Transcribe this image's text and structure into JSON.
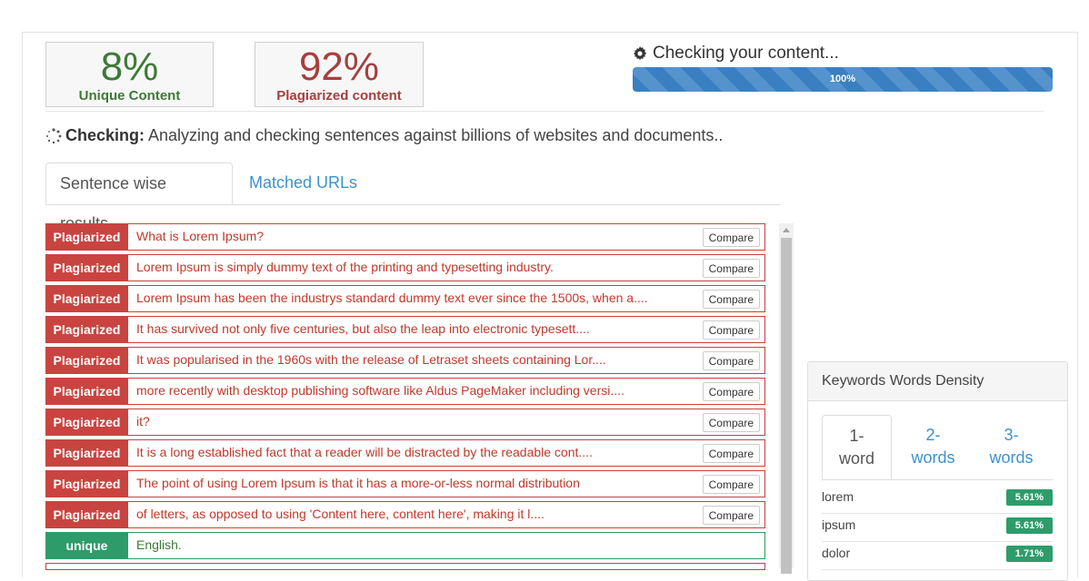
{
  "scores": {
    "unique": {
      "percent": "8%",
      "label": "Unique Content",
      "color": "#3d7a36"
    },
    "plagiarized": {
      "percent": "92%",
      "label": "Plagiarized content",
      "color": "#a5403d"
    }
  },
  "progress": {
    "title": "Checking your content...",
    "icon": "gear-icon",
    "value": 1.0,
    "label": "100%",
    "color": "#3a7fbf"
  },
  "status": {
    "icon": "spinner-icon",
    "label": "Checking:",
    "text": "Analyzing and checking sentences against billions of websites and documents.."
  },
  "tabs": [
    {
      "label": "Sentence wise results",
      "active": true
    },
    {
      "label": "Matched URLs",
      "active": false
    }
  ],
  "results": [
    {
      "status": "Plagiarized",
      "text": "What is Lorem Ipsum?",
      "button": "Compare"
    },
    {
      "status": "Plagiarized",
      "text": "Lorem Ipsum is simply dummy text of the printing and typesetting industry.",
      "button": "Compare"
    },
    {
      "status": "Plagiarized",
      "text": "Lorem Ipsum has been the industrys standard dummy text ever since the 1500s, when a....",
      "button": "Compare"
    },
    {
      "status": "Plagiarized",
      "text": "It has survived not only five centuries, but also the leap into electronic typesett....",
      "button": "Compare"
    },
    {
      "status": "Plagiarized",
      "text": "It was popularised in the 1960s with the release of Letraset sheets containing Lor....",
      "button": "Compare"
    },
    {
      "status": "Plagiarized",
      "text": "more recently with desktop publishing software like Aldus PageMaker including versi....",
      "button": "Compare"
    },
    {
      "status": "Plagiarized",
      "text": "it?",
      "button": "Compare"
    },
    {
      "status": "Plagiarized",
      "text": "It is a long established fact that a reader will be distracted by the readable cont....",
      "button": "Compare"
    },
    {
      "status": "Plagiarized",
      "text": "The point of using Lorem Ipsum is that it has a more-or-less normal distribution",
      "button": "Compare"
    },
    {
      "status": "Plagiarized",
      "text": "of letters, as opposed to using 'Content here, content here', making it l....",
      "button": "Compare"
    },
    {
      "status": "unique",
      "text": "English.",
      "button": ""
    }
  ],
  "colors": {
    "plagiarized": "#c94440",
    "unique": "#2e9c6a",
    "link": "#3a93d1"
  },
  "keywords": {
    "title": "Keywords Words Density",
    "tabs": [
      {
        "line1": "1-",
        "line2": "word",
        "active": true
      },
      {
        "line1": "2-",
        "line2": "words",
        "active": false
      },
      {
        "line1": "3-",
        "line2": "words",
        "active": false
      }
    ],
    "items": [
      {
        "word": "lorem",
        "density": "5.61%"
      },
      {
        "word": "ipsum",
        "density": "5.61%"
      },
      {
        "word": "dolor",
        "density": "1.71%"
      }
    ]
  }
}
